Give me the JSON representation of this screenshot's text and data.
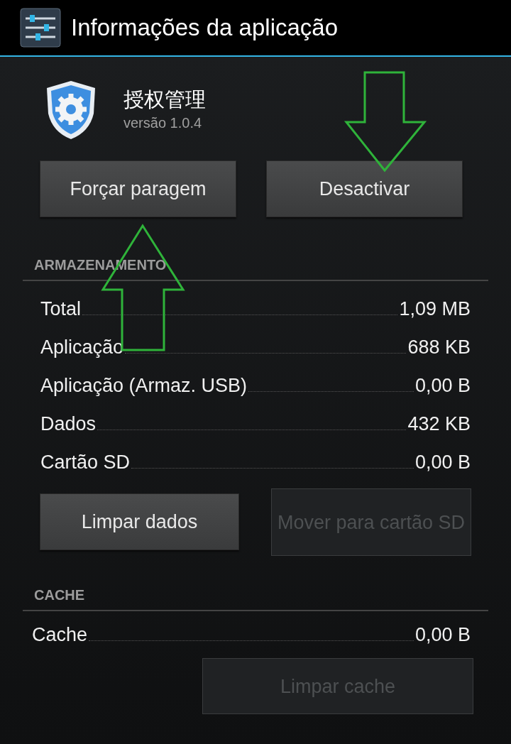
{
  "header": {
    "title": "Informações da aplicação"
  },
  "app": {
    "name": "授权管理",
    "version": "versão 1.0.4"
  },
  "actions": [
    {
      "label": "Forçar paragem",
      "disabled": false
    },
    {
      "label": "Desactivar",
      "disabled": false
    }
  ],
  "storage": {
    "title": "ARMAZENAMENTO",
    "rows": [
      {
        "label": "Total",
        "value": "1,09 MB"
      },
      {
        "label": "Aplicação",
        "value": "688 KB"
      },
      {
        "label": "Aplicação (Armaz. USB)",
        "value": "0,00 B"
      },
      {
        "label": "Dados",
        "value": "432 KB"
      },
      {
        "label": "Cartão SD",
        "value": "0,00 B"
      }
    ],
    "buttons": [
      {
        "label": "Limpar dados",
        "disabled": false
      },
      {
        "label": "Mover para cartão SD",
        "disabled": true
      }
    ]
  },
  "cache": {
    "title": "CACHE",
    "rows": [
      {
        "label": "Cache",
        "value": "0,00 B"
      }
    ],
    "buttons": [
      {
        "label": "Limpar cache",
        "disabled": true
      }
    ]
  }
}
